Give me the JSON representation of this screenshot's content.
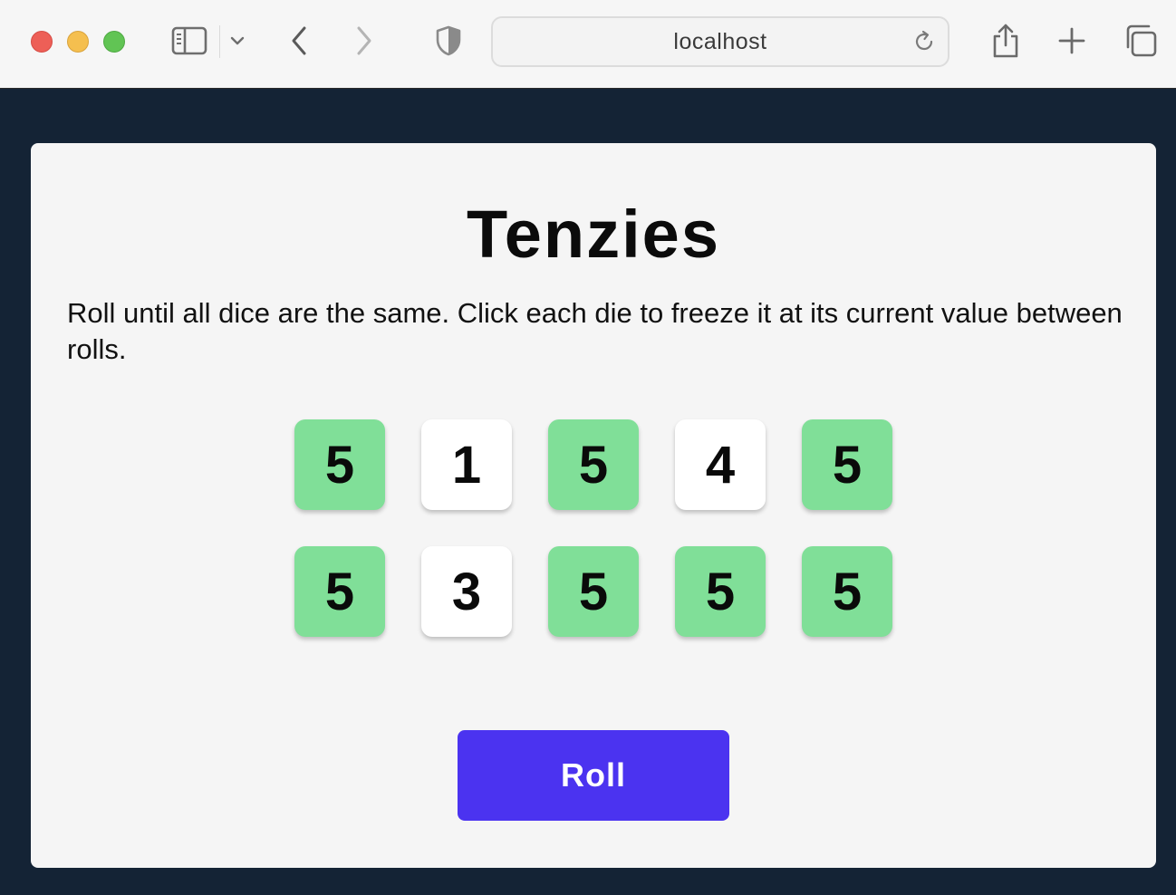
{
  "browser": {
    "address": "localhost",
    "icons": {
      "sidebar": "sidebar-icon",
      "dropdown": "chevron-down-icon",
      "back": "chevron-left-icon",
      "forward": "chevron-right-icon",
      "shield": "shield-icon",
      "reload": "reload-icon",
      "share": "share-icon",
      "new_tab": "plus-icon",
      "tabs": "tabs-overview-icon"
    }
  },
  "game": {
    "title": "Tenzies",
    "instructions": "Roll until all dice are the same. Click each die to freeze it at its current value between rolls.",
    "dice": [
      {
        "value": "5",
        "held": true
      },
      {
        "value": "1",
        "held": false
      },
      {
        "value": "5",
        "held": true
      },
      {
        "value": "4",
        "held": false
      },
      {
        "value": "5",
        "held": true
      },
      {
        "value": "5",
        "held": true
      },
      {
        "value": "3",
        "held": false
      },
      {
        "value": "5",
        "held": true
      },
      {
        "value": "5",
        "held": true
      },
      {
        "value": "5",
        "held": true
      }
    ],
    "roll_label": "Roll"
  },
  "colors": {
    "background": "#142335",
    "card": "#f5f5f5",
    "held_die": "#80df98",
    "die": "#ffffff",
    "roll_button": "#4b33f0"
  }
}
